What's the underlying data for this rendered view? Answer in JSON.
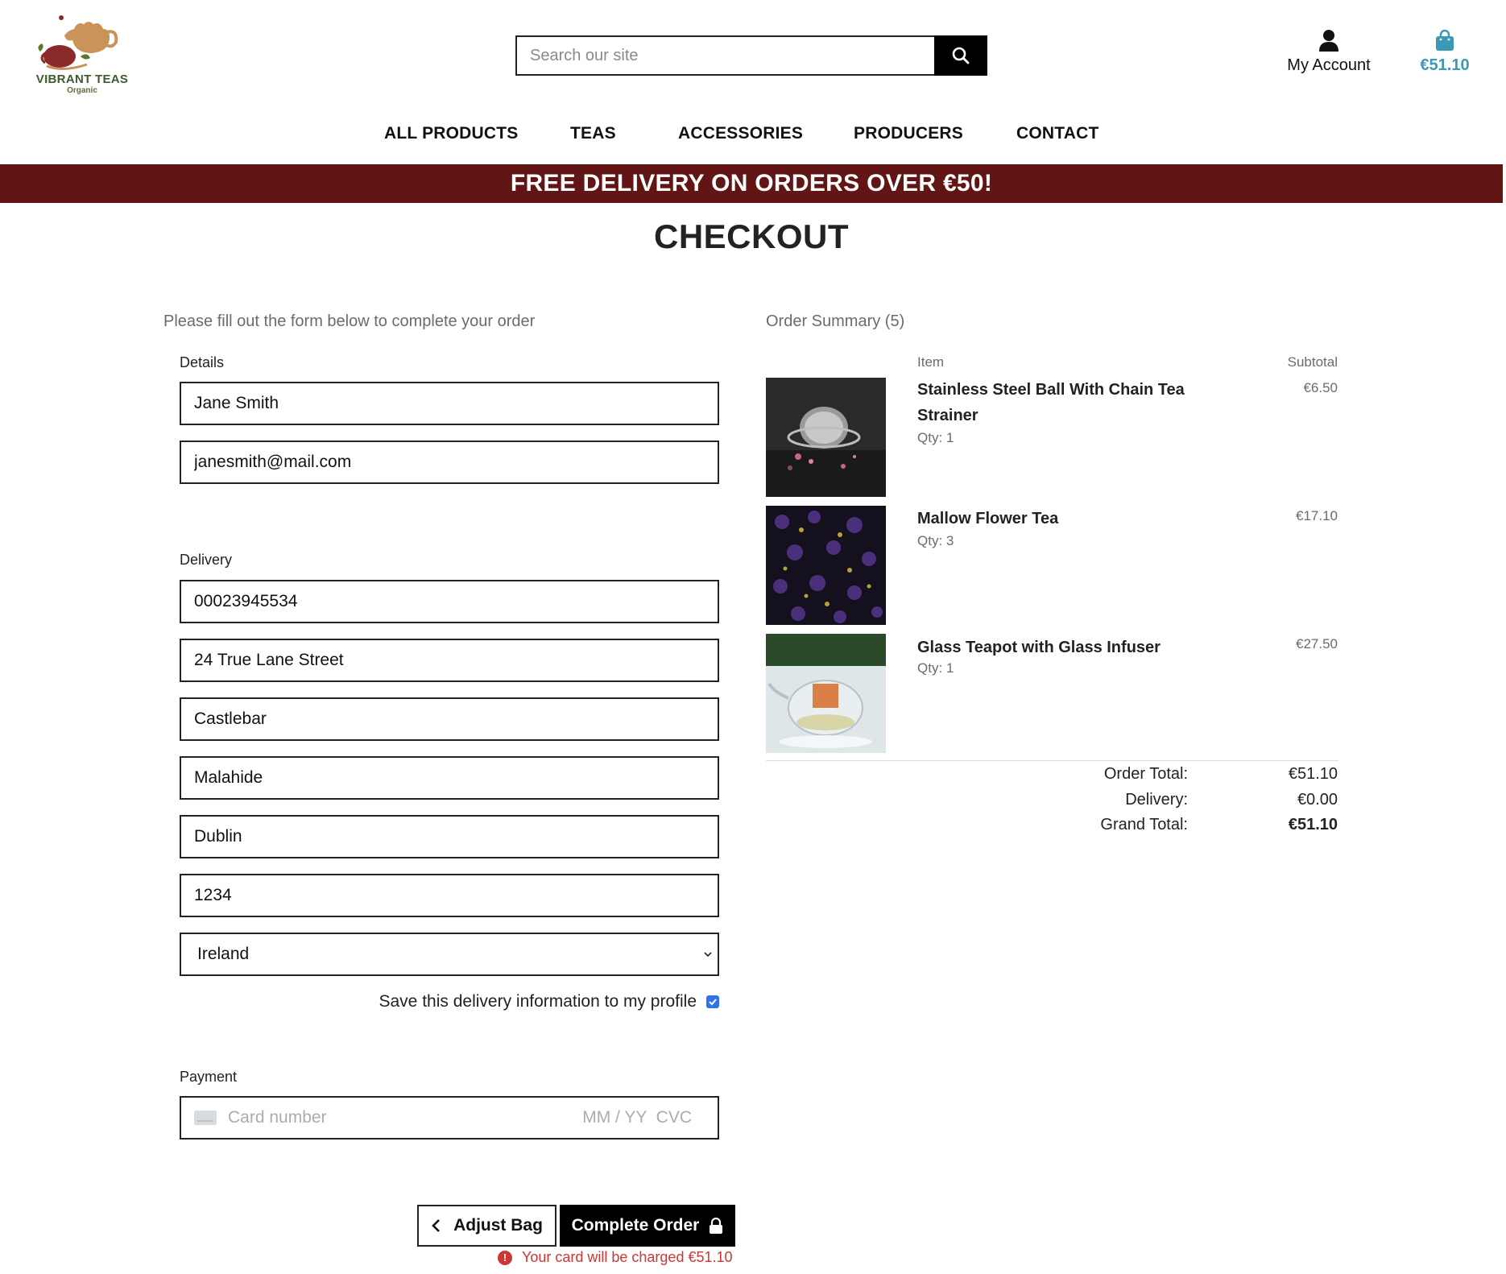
{
  "brand": {
    "name": "VIBRANT TEAS",
    "tagline": "Organic"
  },
  "search": {
    "placeholder": "Search our site"
  },
  "header": {
    "account_label": "My Account",
    "bag_total": "€51.10"
  },
  "nav": {
    "items": [
      "ALL PRODUCTS",
      "TEAS",
      "ACCESSORIES",
      "PRODUCERS",
      "CONTACT"
    ]
  },
  "banner": {
    "text": "FREE DELIVERY ON ORDERS OVER €50!"
  },
  "page": {
    "title": "CHECKOUT"
  },
  "form": {
    "intro": "Please fill out the form below to complete your order",
    "details_label": "Details",
    "full_name": "Jane Smith",
    "email": "janesmith@mail.com",
    "delivery_label": "Delivery",
    "phone": "00023945534",
    "street_address1": "24 True Lane Street",
    "street_address2": "Castlebar",
    "town": "Malahide",
    "county": "Dublin",
    "postcode": "1234",
    "country": "Ireland",
    "save_info_label": "Save this delivery information to my profile",
    "save_info_checked": true,
    "payment_label": "Payment",
    "card_placeholder": "Card number",
    "card_expiry_cvc_placeholder": "MM / YY  CVC"
  },
  "actions": {
    "adjust_bag": "Adjust Bag",
    "complete_order": "Complete Order",
    "charge_note": "Your card will be charged €51.10"
  },
  "summary": {
    "title": "Order Summary (5)",
    "col_item": "Item",
    "col_subtotal": "Subtotal",
    "items": [
      {
        "name": "Stainless Steel Ball With Chain Tea Strainer",
        "qty": "Qty: 1",
        "subtotal": "€6.50"
      },
      {
        "name": "Mallow Flower Tea",
        "qty": "Qty: 3",
        "subtotal": "€17.10"
      },
      {
        "name": "Glass Teapot with Glass Infuser",
        "qty": "Qty: 1",
        "subtotal": "€27.50"
      }
    ],
    "order_total_label": "Order Total:",
    "order_total": "€51.10",
    "delivery_label": "Delivery:",
    "delivery": "€0.00",
    "grand_total_label": "Grand Total:",
    "grand_total": "€51.10"
  },
  "colors": {
    "banner": "#621515",
    "bag_accent": "#3a9ab6",
    "warning": "#d03535",
    "checkbox": "#2f73e8"
  }
}
